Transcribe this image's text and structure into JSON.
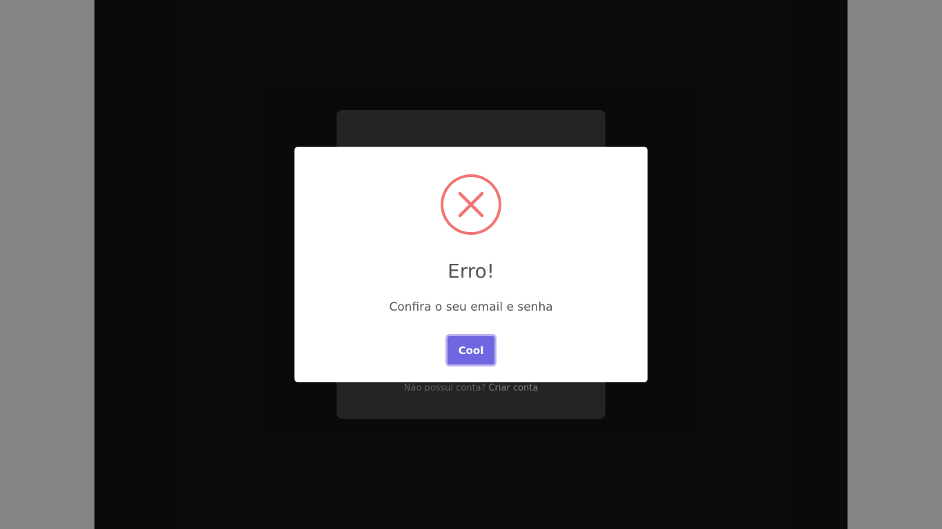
{
  "login_card": {
    "no_account_text": "Não possui conta?",
    "create_account_link": "Criar conta"
  },
  "alert": {
    "icon": "error-x-circle-icon",
    "icon_color": "#f27474",
    "title": "Erro!",
    "message": "Confira o seu email e senha",
    "confirm_label": "Cool",
    "confirm_color": "#7066e0"
  }
}
